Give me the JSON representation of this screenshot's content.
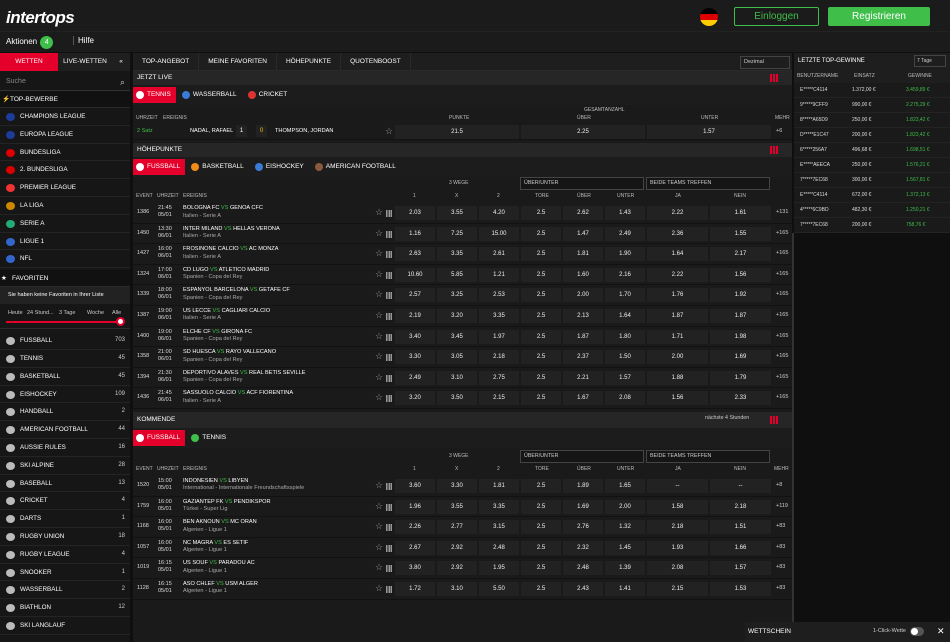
{
  "header": {
    "logo": "intertops",
    "login": "Einloggen",
    "register": "Registrieren",
    "promo": "Aktionen",
    "promo_count": "4",
    "help": "Hilfe"
  },
  "sidebar": {
    "tab_bets": "WETTEN",
    "tab_live": "LIVE-WETTEN",
    "collapse": "«",
    "search_placeholder": "Suche",
    "top_title": "TOP-BEWERBE",
    "top": [
      {
        "label": "CHAMPIONS LEAGUE",
        "color": "#1e3c9a"
      },
      {
        "label": "EUROPA LEAGUE",
        "color": "#1e3c9a"
      },
      {
        "label": "BUNDESLIGA",
        "color": "#d00"
      },
      {
        "label": "2. BUNDESLIGA",
        "color": "#d00"
      },
      {
        "label": "PREMIER LEAGUE",
        "color": "#e33"
      },
      {
        "label": "LA LIGA",
        "color": "#c80"
      },
      {
        "label": "SERIE A",
        "color": "#2a7"
      },
      {
        "label": "LIGUE 1",
        "color": "#36c"
      },
      {
        "label": "NFL",
        "color": "#36c"
      }
    ],
    "fav_title": "FAVORITEN",
    "fav_note": "Sie haben keine Favoriten in Ihrer Liste",
    "ranges": [
      "Heute",
      "24 Stund...",
      "3 Tage",
      "Woche",
      "Alle"
    ],
    "sports": [
      {
        "label": "FUSSBALL",
        "count": "703"
      },
      {
        "label": "TENNIS",
        "count": "45"
      },
      {
        "label": "BASKETBALL",
        "count": "45"
      },
      {
        "label": "EISHOCKEY",
        "count": "109"
      },
      {
        "label": "HANDBALL",
        "count": "2"
      },
      {
        "label": "AMERICAN FOOTBALL",
        "count": "44"
      },
      {
        "label": "AUSSIE RULES",
        "count": "16"
      },
      {
        "label": "SKI ALPINE",
        "count": "28"
      },
      {
        "label": "BASEBALL",
        "count": "13"
      },
      {
        "label": "CRICKET",
        "count": "4"
      },
      {
        "label": "DARTS",
        "count": "1"
      },
      {
        "label": "RUGBY UNION",
        "count": "18"
      },
      {
        "label": "RUGBY LEAGUE",
        "count": "4"
      },
      {
        "label": "SNOOKER",
        "count": "1"
      },
      {
        "label": "WASSERBALL",
        "count": "2"
      },
      {
        "label": "BIATHLON",
        "count": "12"
      },
      {
        "label": "SKI LANGLAUF",
        "count": ""
      }
    ]
  },
  "nav": {
    "items": [
      "TOP-ANGEBOT",
      "MEINE FAVORITEN",
      "HÖHEPUNKTE",
      "QUOTENBOOST"
    ],
    "odds_format": "Dezimal"
  },
  "live": {
    "title": "JETZT LIVE",
    "tabs": [
      "TENNIS",
      "WASSERBALL",
      "CRICKET"
    ],
    "cols": {
      "time": "UHRZEIT",
      "event": "EREIGNIS",
      "total": "GESAMTANZAHL",
      "points": "PUNKTE",
      "over": "ÜBER",
      "under": "UNTER",
      "more": "MEHR"
    },
    "match": {
      "set": "2 Satz",
      "p1": "NADAL, RAFAEL",
      "s1": "1",
      "s2": "0",
      "p2": "THOMPSON, JORDAN",
      "points": "21.5",
      "over": "2.25",
      "under": "1.57",
      "more": "+6"
    }
  },
  "highlights": {
    "title": "HÖHEPUNKTE",
    "tabs": [
      "FUSSBALL",
      "BASKETBALL",
      "EISHOCKEY",
      "AMERICAN FOOTBALL"
    ],
    "group1": "3 WEGE",
    "dd_ou": "ÜBER/UNTER",
    "dd_btts": "BEIDE TEAMS TREFFEN",
    "cols": {
      "event": "EVENT",
      "time": "UHRZEIT",
      "name": "EREIGNIS",
      "c1": "1",
      "cx": "X",
      "c2": "2",
      "goals": "TORE",
      "over": "ÜBER",
      "under": "UNTER",
      "yes": "JA",
      "no": "NEIN",
      "more": "MEHR"
    },
    "rows": [
      {
        "id": "1386",
        "t": "21:45",
        "d": "05/01",
        "h": "BOLOGNA FC",
        "a": "GENOA CFC",
        "l": "Italien - Serie A",
        "o1": "2.03",
        "ox": "3.55",
        "o2": "4.20",
        "g": "2.5",
        "ov": "2.62",
        "un": "1.43",
        "y": "2.22",
        "n": "1.61",
        "m": "+131"
      },
      {
        "id": "1450",
        "t": "13:30",
        "d": "06/01",
        "h": "INTER MILAND",
        "a": "HELLAS VERONA",
        "l": "Italien - Serie A",
        "o1": "1.16",
        "ox": "7.25",
        "o2": "15.00",
        "g": "2.5",
        "ov": "1.47",
        "un": "2.49",
        "y": "2.36",
        "n": "1.55",
        "m": "+165"
      },
      {
        "id": "1427",
        "t": "16:00",
        "d": "06/01",
        "h": "FROSINONE CALCIO",
        "a": "AC MONZA",
        "l": "Italien - Serie A",
        "o1": "2.63",
        "ox": "3.35",
        "o2": "2.61",
        "g": "2.5",
        "ov": "1.81",
        "un": "1.90",
        "y": "1.64",
        "n": "2.17",
        "m": "+165"
      },
      {
        "id": "1324",
        "t": "17:00",
        "d": "06/01",
        "h": "CD LUGO",
        "a": "ATLETICO MADRID",
        "l": "Spanien - Copa del Rey",
        "o1": "10.60",
        "ox": "5.85",
        "o2": "1.21",
        "g": "2.5",
        "ov": "1.60",
        "un": "2.16",
        "y": "2.22",
        "n": "1.56",
        "m": "+165"
      },
      {
        "id": "1339",
        "t": "18:00",
        "d": "06/01",
        "h": "ESPANYOL BARCELONA",
        "a": "GETAFE CF",
        "l": "Spanien - Copa del Rey",
        "o1": "2.57",
        "ox": "3.25",
        "o2": "2.53",
        "g": "2.5",
        "ov": "2.00",
        "un": "1.70",
        "y": "1.76",
        "n": "1.92",
        "m": "+165"
      },
      {
        "id": "1387",
        "t": "19:00",
        "d": "06/01",
        "h": "US LECCE",
        "a": "CAGLIARI CALCIO",
        "l": "Italien - Serie A",
        "o1": "2.19",
        "ox": "3.20",
        "o2": "3.35",
        "g": "2.5",
        "ov": "2.13",
        "un": "1.64",
        "y": "1.87",
        "n": "1.87",
        "m": "+165"
      },
      {
        "id": "1400",
        "t": "19:00",
        "d": "06/01",
        "h": "ELCHE CF",
        "a": "GIRONA FC",
        "l": "Spanien - Copa del Rey",
        "o1": "3.40",
        "ox": "3.45",
        "o2": "1.97",
        "g": "2.5",
        "ov": "1.87",
        "un": "1.80",
        "y": "1.71",
        "n": "1.98",
        "m": "+165"
      },
      {
        "id": "1358",
        "t": "21:00",
        "d": "06/01",
        "h": "SD HUESCA",
        "a": "RAYO VALLECANO",
        "l": "Spanien - Copa del Rey",
        "o1": "3.30",
        "ox": "3.05",
        "o2": "2.18",
        "g": "2.5",
        "ov": "2.37",
        "un": "1.50",
        "y": "2.00",
        "n": "1.69",
        "m": "+165"
      },
      {
        "id": "1394",
        "t": "21:30",
        "d": "06/01",
        "h": "DEPORTIVO ALAVES",
        "a": "REAL BETIS SEVILLE",
        "l": "Spanien - Copa del Rey",
        "o1": "2.49",
        "ox": "3.10",
        "o2": "2.75",
        "g": "2.5",
        "ov": "2.21",
        "un": "1.57",
        "y": "1.88",
        "n": "1.79",
        "m": "+165"
      },
      {
        "id": "1436",
        "t": "21:45",
        "d": "06/01",
        "h": "SASSUOLO CALCIO",
        "a": "ACF FIORENTINA",
        "l": "Italien - Serie A",
        "o1": "3.20",
        "ox": "3.50",
        "o2": "2.15",
        "g": "2.5",
        "ov": "1.67",
        "un": "2.08",
        "y": "1.56",
        "n": "2.33",
        "m": "+165"
      }
    ]
  },
  "upcoming": {
    "title": "KOMMENDE",
    "window": "nächste 4 Stunden",
    "tabs": [
      "FUSSBALL",
      "TENNIS"
    ],
    "group1": "3 WEGE",
    "dd_ou": "ÜBER/UNTER",
    "dd_btts": "BEIDE TEAMS TREFFEN",
    "rows": [
      {
        "id": "1520",
        "t": "15:00",
        "d": "05/01",
        "h": "INDONESIEN",
        "a": "LIBYEN",
        "l": "International - Internationale Freundschaftsspiele",
        "o1": "3.60",
        "ox": "3.30",
        "o2": "1.81",
        "g": "2.5",
        "ov": "1.89",
        "un": "1.65",
        "y": "--",
        "n": "--",
        "m": "+8"
      },
      {
        "id": "1759",
        "t": "16:00",
        "d": "05/01",
        "h": "GAZIANTEP FK",
        "a": "PENDIKSPOR",
        "l": "Türkei - Super Lig",
        "o1": "1.96",
        "ox": "3.55",
        "o2": "3.35",
        "g": "2.5",
        "ov": "1.69",
        "un": "2.00",
        "y": "1.58",
        "n": "2.18",
        "m": "+119"
      },
      {
        "id": "1168",
        "t": "16:00",
        "d": "05/01",
        "h": "BEN AKNOUN",
        "a": "MC ORAN",
        "l": "Algerien - Ligue 1",
        "o1": "2.26",
        "ox": "2.77",
        "o2": "3.15",
        "g": "2.5",
        "ov": "2.76",
        "un": "1.32",
        "y": "2.18",
        "n": "1.51",
        "m": "+83"
      },
      {
        "id": "1057",
        "t": "16:00",
        "d": "05/01",
        "h": "NC MAGRA",
        "a": "ES SETIF",
        "l": "Algerien - Ligue 1",
        "o1": "2.67",
        "ox": "2.92",
        "o2": "2.48",
        "g": "2.5",
        "ov": "2.32",
        "un": "1.45",
        "y": "1.93",
        "n": "1.66",
        "m": "+83"
      },
      {
        "id": "1019",
        "t": "16:15",
        "d": "05/01",
        "h": "US SOUF",
        "a": "PARADOU AC",
        "l": "Algerien - Ligue 1",
        "o1": "3.80",
        "ox": "2.92",
        "o2": "1.95",
        "g": "2.5",
        "ov": "2.48",
        "un": "1.39",
        "y": "2.08",
        "n": "1.57",
        "m": "+83"
      },
      {
        "id": "1128",
        "t": "16:15",
        "d": "05/01",
        "h": "ASO CHLEF",
        "a": "USM ALGER",
        "l": "Algerien - Ligue 1",
        "o1": "1.72",
        "ox": "3.10",
        "o2": "5.50",
        "g": "2.5",
        "ov": "2.43",
        "un": "1.41",
        "y": "2.15",
        "n": "1.53",
        "m": "+83"
      }
    ]
  },
  "wins": {
    "title": "LETZTE TOP-GEWINNE",
    "period": "7 Tage",
    "cols": [
      "BENUTZERNAME",
      "EINSATZ",
      "GEWINNE"
    ],
    "rows": [
      {
        "u": "E*****C4114",
        "s": "1.372,00 €",
        "w": "3.459,89 €"
      },
      {
        "u": "9*****9CFF9",
        "s": "990,00 €",
        "w": "2.275,29 €"
      },
      {
        "u": "8*****A65D9",
        "s": "250,00 €",
        "w": "1.823,42 €"
      },
      {
        "u": "D*****E1C47",
        "s": "200,00 €",
        "w": "1.823,42 €"
      },
      {
        "u": "6*****256A7",
        "s": "496,68 €",
        "w": "1.698,51 €"
      },
      {
        "u": "E*****AEECA",
        "s": "250,00 €",
        "w": "1.576,21 €"
      },
      {
        "u": "7*****7EC68",
        "s": "300,00 €",
        "w": "1.567,81 €"
      },
      {
        "u": "E*****C4114",
        "s": "672,00 €",
        "w": "1.372,13 €"
      },
      {
        "u": "4*****6C9BD",
        "s": "482,30 €",
        "w": "1.250,21 €"
      },
      {
        "u": "7*****7EC68",
        "s": "200,00 €",
        "w": "758,76 €"
      }
    ]
  },
  "slip": {
    "label": "WETTSCHEIN",
    "oneclick": "1-Click-Wette",
    "close": "✕"
  },
  "colors": {
    "accent": "#e4002b",
    "green": "#3fbf4a"
  }
}
